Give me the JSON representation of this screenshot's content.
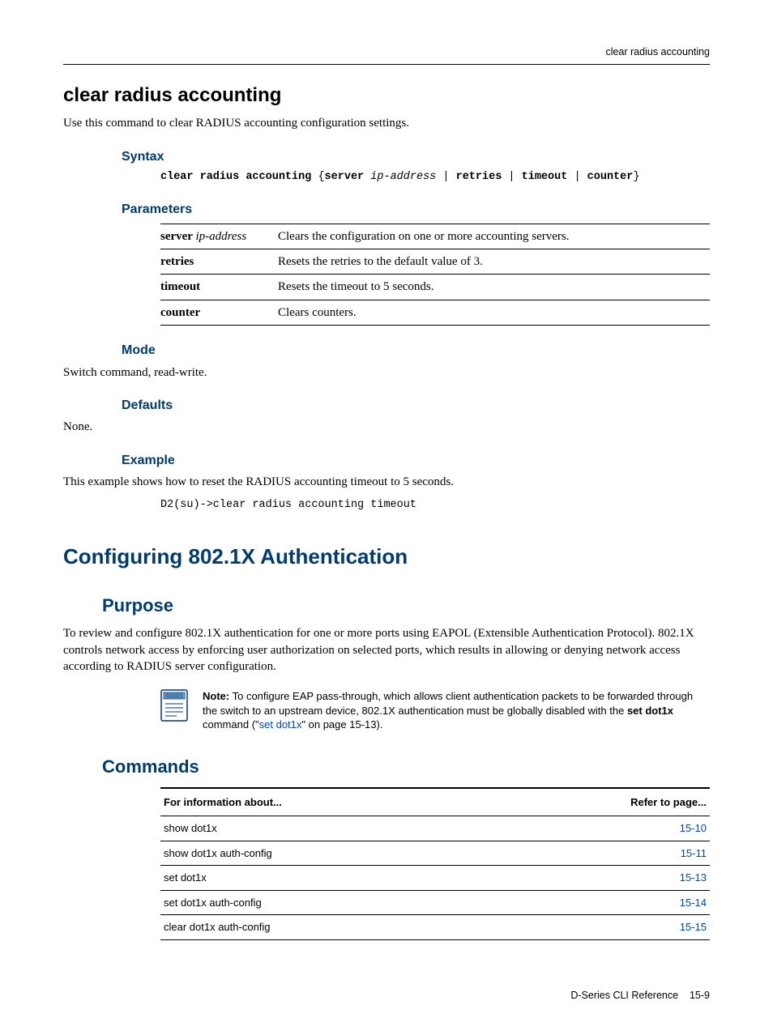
{
  "running_header": "clear radius accounting",
  "cmd": {
    "title": "clear radius accounting",
    "desc": "Use this command to clear RADIUS accounting configuration settings."
  },
  "syntax": {
    "heading": "Syntax",
    "cmd": "clear radius accounting",
    "opt_server": "server",
    "opt_ip": "ip-address",
    "opt_retries": "retries",
    "opt_timeout": "timeout",
    "opt_counter": "counter"
  },
  "params": {
    "heading": "Parameters",
    "rows": [
      {
        "name": "server",
        "sub": "ip-address",
        "desc": "Clears the configuration on one or more accounting servers."
      },
      {
        "name": "retries",
        "sub": "",
        "desc": "Resets the retries to the default value of 3."
      },
      {
        "name": "timeout",
        "sub": "",
        "desc": "Resets the timeout to 5 seconds."
      },
      {
        "name": "counter",
        "sub": "",
        "desc": "Clears counters."
      }
    ]
  },
  "mode": {
    "heading": "Mode",
    "text": "Switch command, read-write."
  },
  "defaults": {
    "heading": "Defaults",
    "text": "None."
  },
  "example": {
    "heading": "Example",
    "text": "This example shows how to reset the RADIUS accounting timeout to 5 seconds.",
    "code": "D2(su)->clear radius accounting timeout"
  },
  "section": {
    "title": "Configuring 802.1X Authentication",
    "purpose_heading": "Purpose",
    "purpose_text": "To review and configure 802.1X authentication for one or more ports using EAPOL (Extensible Authentication Protocol). 802.1X controls network access by enforcing user authorization on selected ports, which results in allowing or denying network access according to RADIUS server configuration."
  },
  "note": {
    "label": "Note:",
    "part1": " To configure EAP pass-through, which allows client authentication packets to be forwarded through the switch to an upstream device, 802.1X authentication must be globally disabled with the ",
    "cmd": "set dot1x",
    "part2": " command (\"",
    "link": "set dot1x",
    "part3": "\" on page 15-13)."
  },
  "commands": {
    "heading": "Commands",
    "col1": "For information about...",
    "col2": "Refer to page...",
    "rows": [
      {
        "name": "show dot1x",
        "page": "15-10"
      },
      {
        "name": "show dot1x auth-config",
        "page": "15-11"
      },
      {
        "name": "set dot1x",
        "page": "15-13"
      },
      {
        "name": "set dot1x auth-config",
        "page": "15-14"
      },
      {
        "name": "clear dot1x auth-config",
        "page": "15-15"
      }
    ]
  },
  "footer": {
    "doc": "D-Series CLI Reference",
    "page": "15-9"
  }
}
